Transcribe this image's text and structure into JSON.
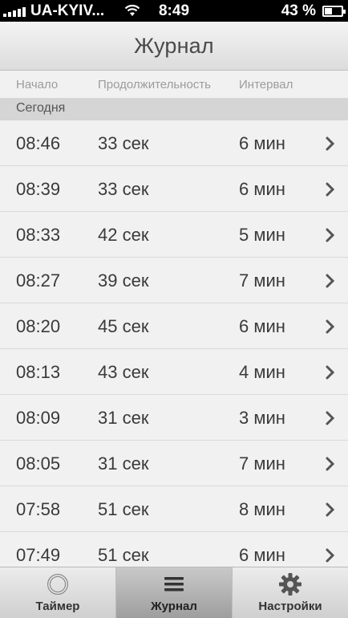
{
  "status_bar": {
    "carrier": "UA-KYIV...",
    "time": "8:49",
    "battery_text": "43 %",
    "battery_level": 0.43
  },
  "nav": {
    "title": "Журнал"
  },
  "columns": {
    "start": "Начало",
    "duration": "Продолжительность",
    "interval": "Интервал"
  },
  "section": {
    "title": "Сегодня"
  },
  "rows": [
    {
      "start": "08:46",
      "duration": "33 сек",
      "interval": "6 мин"
    },
    {
      "start": "08:39",
      "duration": "33 сек",
      "interval": "6 мин"
    },
    {
      "start": "08:33",
      "duration": "42 сек",
      "interval": "5 мин"
    },
    {
      "start": "08:27",
      "duration": "39 сек",
      "interval": "7 мин"
    },
    {
      "start": "08:20",
      "duration": "45 сек",
      "interval": "6 мин"
    },
    {
      "start": "08:13",
      "duration": "43 сек",
      "interval": "4 мин"
    },
    {
      "start": "08:09",
      "duration": "31 сек",
      "interval": "3 мин"
    },
    {
      "start": "08:05",
      "duration": "31 сек",
      "interval": "7 мин"
    },
    {
      "start": "07:58",
      "duration": "51 сек",
      "interval": "8 мин"
    },
    {
      "start": "07:49",
      "duration": "51 сек",
      "interval": "6 мин"
    }
  ],
  "tabs": [
    {
      "label": "Таймер",
      "icon": "timer-ring-icon",
      "active": false
    },
    {
      "label": "Журнал",
      "icon": "list-icon",
      "active": true
    },
    {
      "label": "Настройки",
      "icon": "gear-icon",
      "active": false
    }
  ]
}
